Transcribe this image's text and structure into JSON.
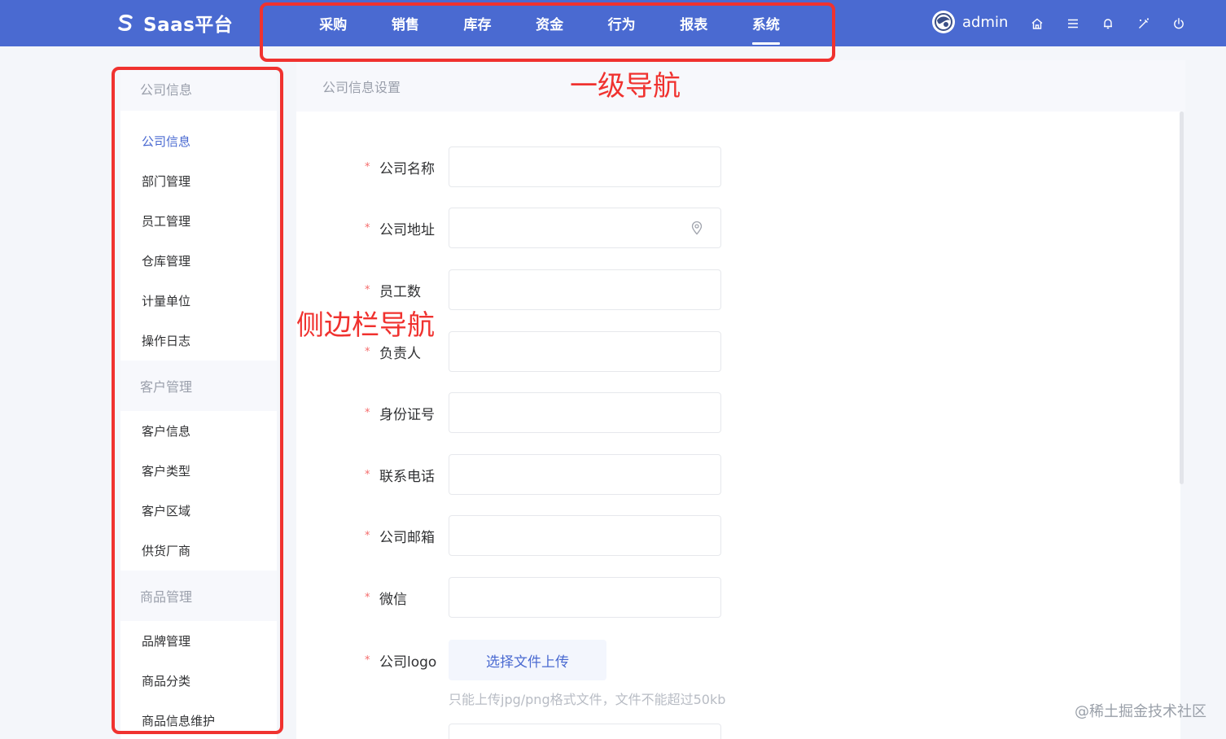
{
  "app": {
    "name": "Saas平台",
    "logo_icon": "saas-s-logo-icon"
  },
  "main_nav": {
    "items": [
      {
        "label": "采购"
      },
      {
        "label": "销售"
      },
      {
        "label": "库存"
      },
      {
        "label": "资金"
      },
      {
        "label": "行为"
      },
      {
        "label": "报表"
      },
      {
        "label": "系统",
        "active": true
      }
    ]
  },
  "user": {
    "name": "admin",
    "avatar_icon": "avatar-icon"
  },
  "toolbar_icons": [
    "home-icon",
    "menu-icon",
    "bell-icon",
    "magic-wand-icon",
    "power-icon"
  ],
  "annotations": {
    "top_nav": "一级导航",
    "sidebar": "侧边栏导航"
  },
  "sidebar": {
    "groups": [
      {
        "title": "公司信息",
        "items": [
          {
            "label": "公司信息",
            "active": true
          },
          {
            "label": "部门管理"
          },
          {
            "label": "员工管理"
          },
          {
            "label": "仓库管理"
          },
          {
            "label": "计量单位"
          },
          {
            "label": "操作日志"
          }
        ]
      },
      {
        "title": "客户管理",
        "items": [
          {
            "label": "客户信息"
          },
          {
            "label": "客户类型"
          },
          {
            "label": "客户区域"
          },
          {
            "label": "供货厂商"
          }
        ]
      },
      {
        "title": "商品管理",
        "items": [
          {
            "label": "品牌管理"
          },
          {
            "label": "商品分类"
          },
          {
            "label": "商品信息维护"
          }
        ]
      }
    ]
  },
  "main": {
    "title": "公司信息设置",
    "form": {
      "required_mark": "*",
      "fields": [
        {
          "label": "公司名称",
          "value": ""
        },
        {
          "label": "公司地址",
          "value": "",
          "icon": "location-pin-icon"
        },
        {
          "label": "员工数",
          "value": ""
        },
        {
          "label": "负责人",
          "value": ""
        },
        {
          "label": "身份证号",
          "value": ""
        },
        {
          "label": "联系电话",
          "value": ""
        },
        {
          "label": "公司邮箱",
          "value": ""
        },
        {
          "label": "微信",
          "value": ""
        }
      ],
      "logo": {
        "label": "公司logo",
        "button_label": "选择文件上传",
        "hint": "只能上传jpg/png格式文件，文件不能超过50kb"
      }
    }
  },
  "watermark": "@稀土掘金技术社区",
  "colors": {
    "primary": "#4a6ad1",
    "annotation": "#f0322f",
    "required": "#f56c6c"
  }
}
